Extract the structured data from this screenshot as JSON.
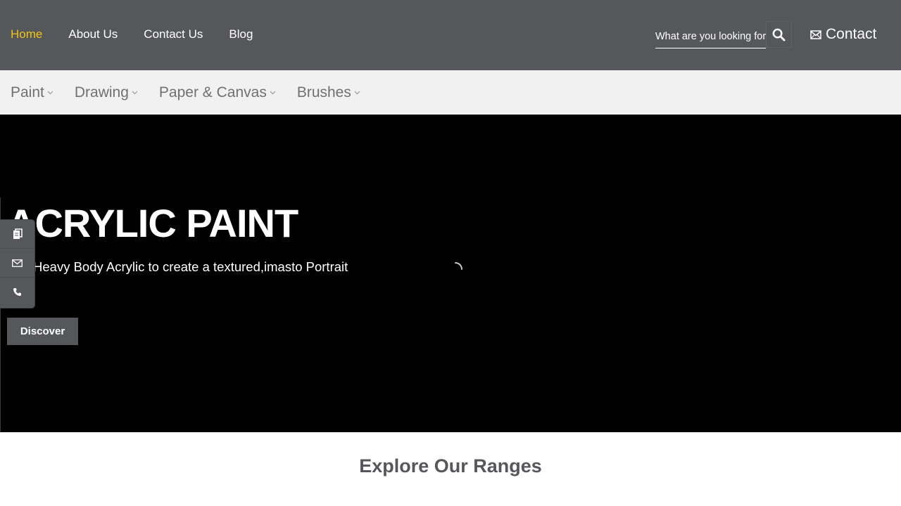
{
  "top_nav": {
    "items": [
      {
        "label": "Home",
        "active": true
      },
      {
        "label": "About Us",
        "active": false
      },
      {
        "label": "Contact Us",
        "active": false
      },
      {
        "label": "Blog",
        "active": false
      }
    ],
    "active_color": "#f0c419"
  },
  "search": {
    "placeholder": "What are you looking for",
    "icon": "search-icon"
  },
  "contact": {
    "label": "Contact",
    "icon": "mail-icon"
  },
  "category_nav": {
    "items": [
      {
        "label": "Paint"
      },
      {
        "label": "Drawing"
      },
      {
        "label": "Paper & Canvas"
      },
      {
        "label": "Brushes"
      }
    ],
    "dropdown_icon": "chevron-down-icon"
  },
  "hero": {
    "title": "ACRYLIC PAINT",
    "subtitle": "Heavy Body Acrylic to create a textured,imasto Portrait",
    "button_label": "Discover",
    "loading_icon": "spinner-icon"
  },
  "side_dock": {
    "icons": [
      "copy-icon",
      "mail-icon",
      "phone-icon"
    ]
  },
  "ranges": {
    "title": "Explore Our Ranges"
  },
  "colors": {
    "header_bg": "#55575b",
    "category_bg": "#f1f1f1",
    "hero_bg": "#000000",
    "accent": "#f0c419"
  }
}
